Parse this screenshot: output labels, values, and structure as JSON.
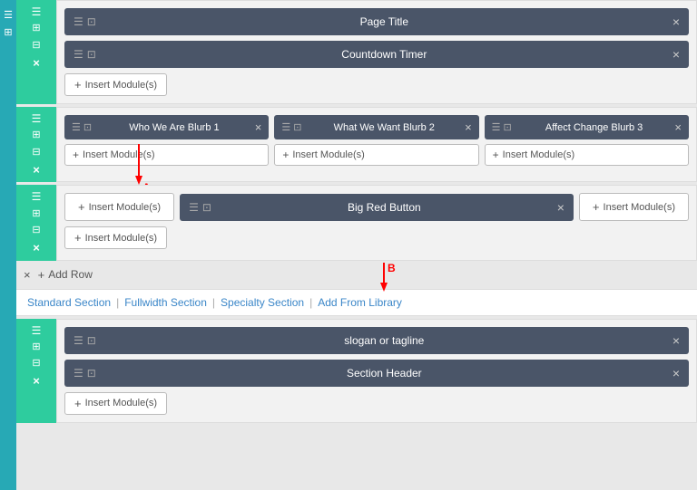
{
  "sidebar": {
    "icons": [
      "≡",
      "⊞",
      "⊟",
      "⊠"
    ]
  },
  "sections": [
    {
      "id": "section-1",
      "sidebarIcons": [
        "≡",
        "⊞",
        "⊟",
        "⊠"
      ],
      "rows": [
        {
          "type": "single",
          "modules": [
            {
              "title": "Page Title",
              "icons": true
            }
          ]
        },
        {
          "type": "single",
          "modules": [
            {
              "title": "Countdown Timer",
              "icons": true
            }
          ]
        }
      ],
      "insertLabel": "Insert Module(s)"
    },
    {
      "id": "section-2",
      "sidebarIcons": [
        "≡",
        "⊞",
        "⊟",
        "⊠"
      ],
      "rows": [
        {
          "type": "three-col",
          "columns": [
            {
              "title": "Who We Are Blurb 1",
              "insertLabel": "Insert Module(s)"
            },
            {
              "title": "What We Want Blurb 2",
              "insertLabel": "Insert Module(s)"
            },
            {
              "title": "Affect Change Blurb 3",
              "insertLabel": "Insert Module(s)"
            }
          ]
        }
      ],
      "annotation": "A"
    },
    {
      "id": "section-3",
      "sidebarIcons": [
        "≡",
        "⊞",
        "⊟",
        "⊠"
      ],
      "rows": [
        {
          "type": "three-col-special",
          "left": {
            "insertLabel": "Insert Module(s)"
          },
          "center": {
            "title": "Big Red Button"
          },
          "right": {
            "insertLabel": "Insert Module(s)"
          }
        },
        {
          "type": "insert-only",
          "insertLabel": "Insert Module(s)"
        }
      ]
    }
  ],
  "addRow": {
    "label": "Add Row"
  },
  "bottomBar": {
    "items": [
      "Standard Section",
      "Fullwidth Section",
      "Specialty Section",
      "Add From Library"
    ],
    "separators": [
      "|",
      "|",
      "|"
    ]
  },
  "sections2": [
    {
      "id": "section-4",
      "rows": [
        {
          "title": "slogan or tagline",
          "icons": true
        },
        {
          "title": "Section Header",
          "icons": true
        }
      ],
      "insertLabel": "Insert Module(s)",
      "annotation": "B"
    }
  ],
  "labels": {
    "insert_module": "Insert Module(s)",
    "add_row": "Add Row",
    "close": "×",
    "plus": "+"
  },
  "colors": {
    "teal_sidebar": "#2ecc9e",
    "blue_sidebar": "#2196a8",
    "module_bg": "#4a5568",
    "section_bg": "#f0f0f0"
  }
}
